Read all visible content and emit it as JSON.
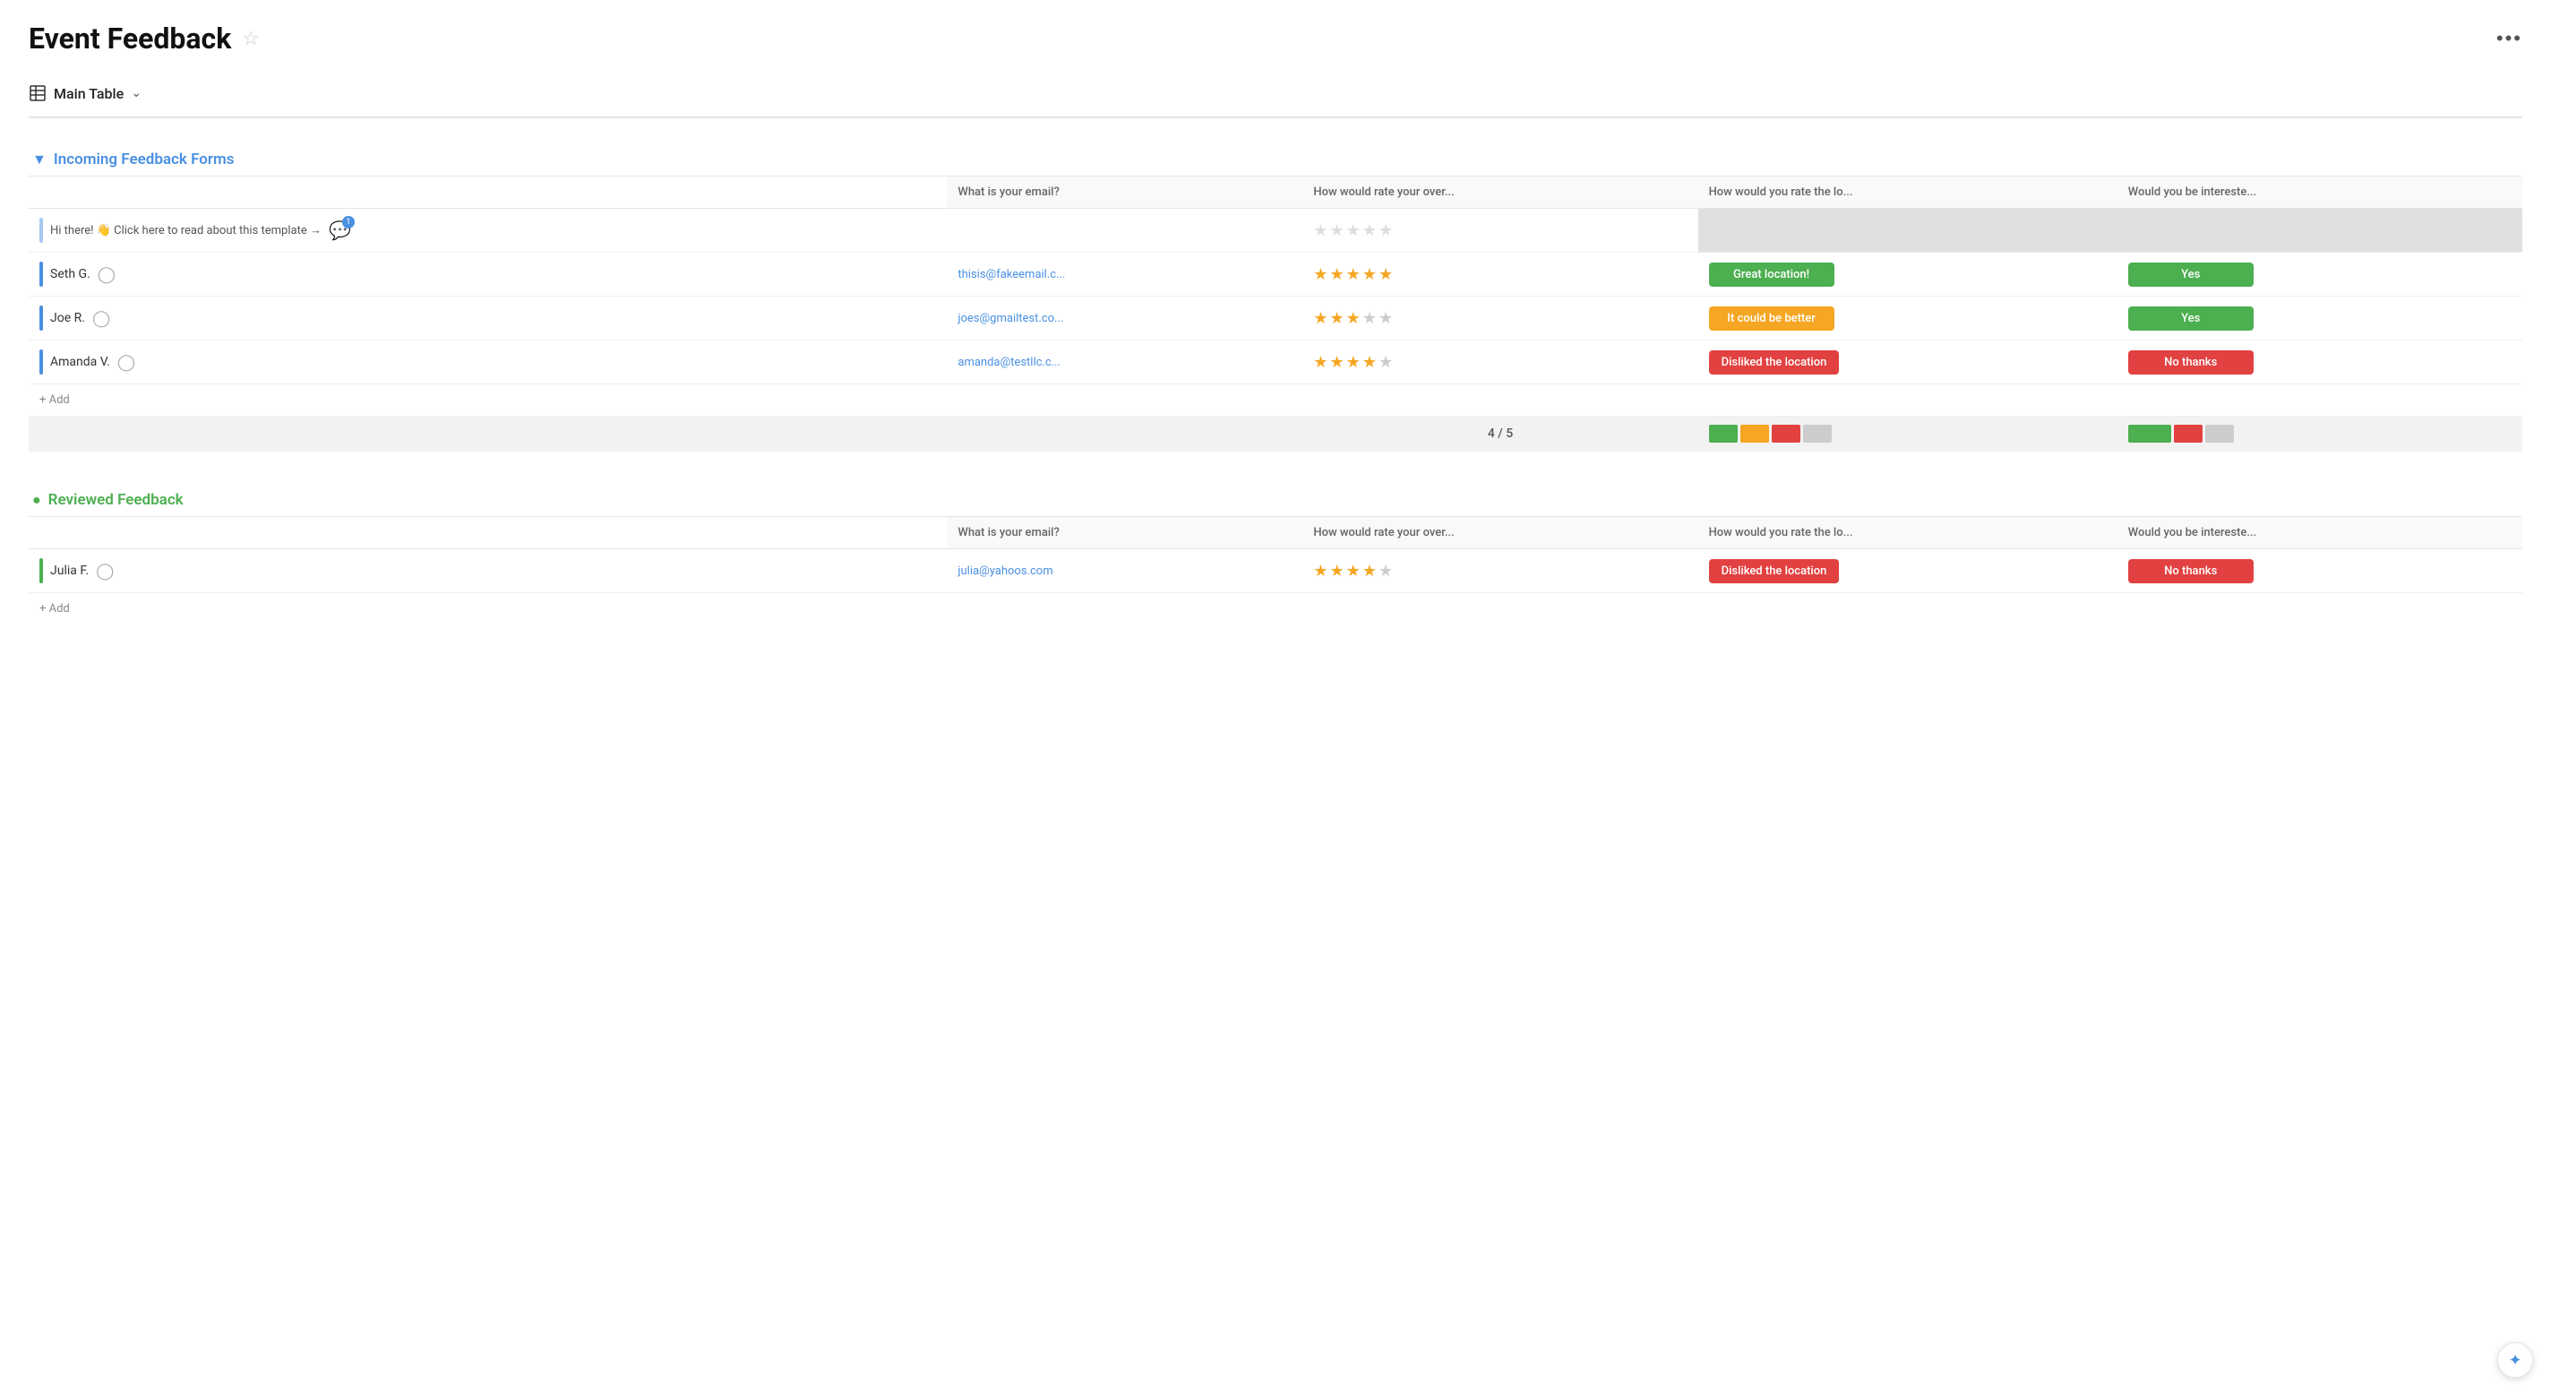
{
  "header": {
    "title": "Event Feedback",
    "star_icon": "☆",
    "more_icon": "•••"
  },
  "toolbar": {
    "table_icon": "table",
    "view_label": "Main Table",
    "chevron": "∨"
  },
  "groups": [
    {
      "id": "incoming",
      "toggle_icon": "▼",
      "name": "Incoming Feedback Forms",
      "color": "blue",
      "columns": [
        "What is your email?",
        "How would rate your over...",
        "How would you rate the lo...",
        "Would you be intereste..."
      ],
      "rows": [
        {
          "id": "template",
          "name": "Hi there! 👋 Click here to read about this template →",
          "has_badge": true,
          "badge_count": "1",
          "email": "",
          "stars": [
            0,
            0,
            0,
            0,
            0
          ],
          "location": "",
          "interested": ""
        },
        {
          "id": "seth",
          "name": "Seth G.",
          "has_badge": false,
          "email": "thisis@fakeemail.c...",
          "stars": [
            1,
            1,
            1,
            1,
            1
          ],
          "location": "Great location!",
          "location_color": "green",
          "interested": "Yes",
          "interested_color": "green"
        },
        {
          "id": "joe",
          "name": "Joe R.",
          "has_badge": false,
          "email": "joes@gmailtest.co...",
          "stars": [
            1,
            1,
            1,
            0,
            0
          ],
          "location": "It could be better",
          "location_color": "orange",
          "interested": "Yes",
          "interested_color": "green"
        },
        {
          "id": "amanda",
          "name": "Amanda V.",
          "has_badge": false,
          "email": "amanda@testllc.c...",
          "stars": [
            1,
            1,
            1,
            1,
            0
          ],
          "location": "Disliked the location",
          "location_color": "red",
          "interested": "No thanks",
          "interested_color": "red"
        }
      ],
      "add_label": "+ Add",
      "summary": {
        "count": "4 / 5",
        "location_segments": [
          {
            "color": "#4CAF50",
            "width": 28
          },
          {
            "color": "#F5A623",
            "width": 28
          },
          {
            "color": "#E24141",
            "width": 28
          },
          {
            "color": "#ccc",
            "width": 28
          }
        ],
        "interested_segments": [
          {
            "color": "#4CAF50",
            "width": 42
          },
          {
            "color": "#E24141",
            "width": 28
          },
          {
            "color": "#ccc",
            "width": 28
          }
        ]
      }
    },
    {
      "id": "reviewed",
      "toggle_icon": "●",
      "name": "Reviewed Feedback",
      "color": "green",
      "columns": [
        "What is your email?",
        "How would rate your over...",
        "How would you rate the lo...",
        "Would you be intereste..."
      ],
      "rows": [
        {
          "id": "julia",
          "name": "Julia F.",
          "has_badge": false,
          "email": "julia@yahoos.com",
          "stars": [
            1,
            1,
            1,
            1,
            0
          ],
          "location": "Disliked the location",
          "location_color": "red",
          "interested": "No thanks",
          "interested_color": "red"
        }
      ],
      "add_label": "+ Add"
    }
  ],
  "fab_icon": "✦"
}
